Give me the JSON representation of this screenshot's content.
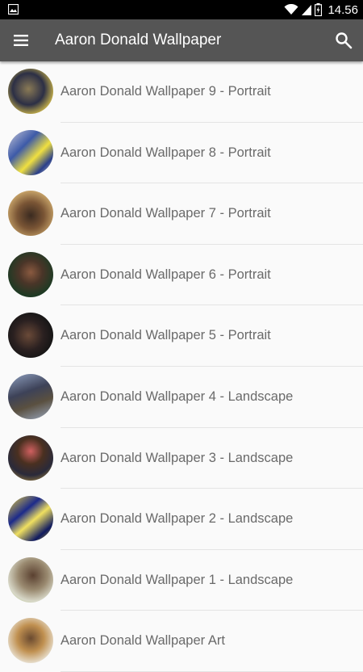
{
  "status_bar": {
    "time": "14.56",
    "icons": [
      "gallery-icon",
      "wifi-icon",
      "signal-icon",
      "battery-icon"
    ]
  },
  "toolbar": {
    "title": "Aaron Donald Wallpaper",
    "icons": [
      "menu-icon",
      "search-icon"
    ]
  },
  "list": {
    "items": [
      {
        "label": "Aaron Donald Wallpaper 9 - Portrait"
      },
      {
        "label": "Aaron Donald Wallpaper 8 - Portrait"
      },
      {
        "label": "Aaron Donald Wallpaper 7 - Portrait"
      },
      {
        "label": "Aaron Donald Wallpaper 6 - Portrait"
      },
      {
        "label": "Aaron Donald Wallpaper 5 - Portrait"
      },
      {
        "label": "Aaron Donald Wallpaper 4 - Landscape"
      },
      {
        "label": "Aaron Donald Wallpaper 3 - Landscape"
      },
      {
        "label": "Aaron Donald Wallpaper 2 - Landscape"
      },
      {
        "label": "Aaron Donald Wallpaper 1 - Landscape"
      },
      {
        "label": "Aaron Donald Wallpaper Art"
      }
    ]
  },
  "colors": {
    "status_bar": "#000000",
    "toolbar": "#555555",
    "background": "#fafafa",
    "label_text": "#6a6a6a"
  }
}
